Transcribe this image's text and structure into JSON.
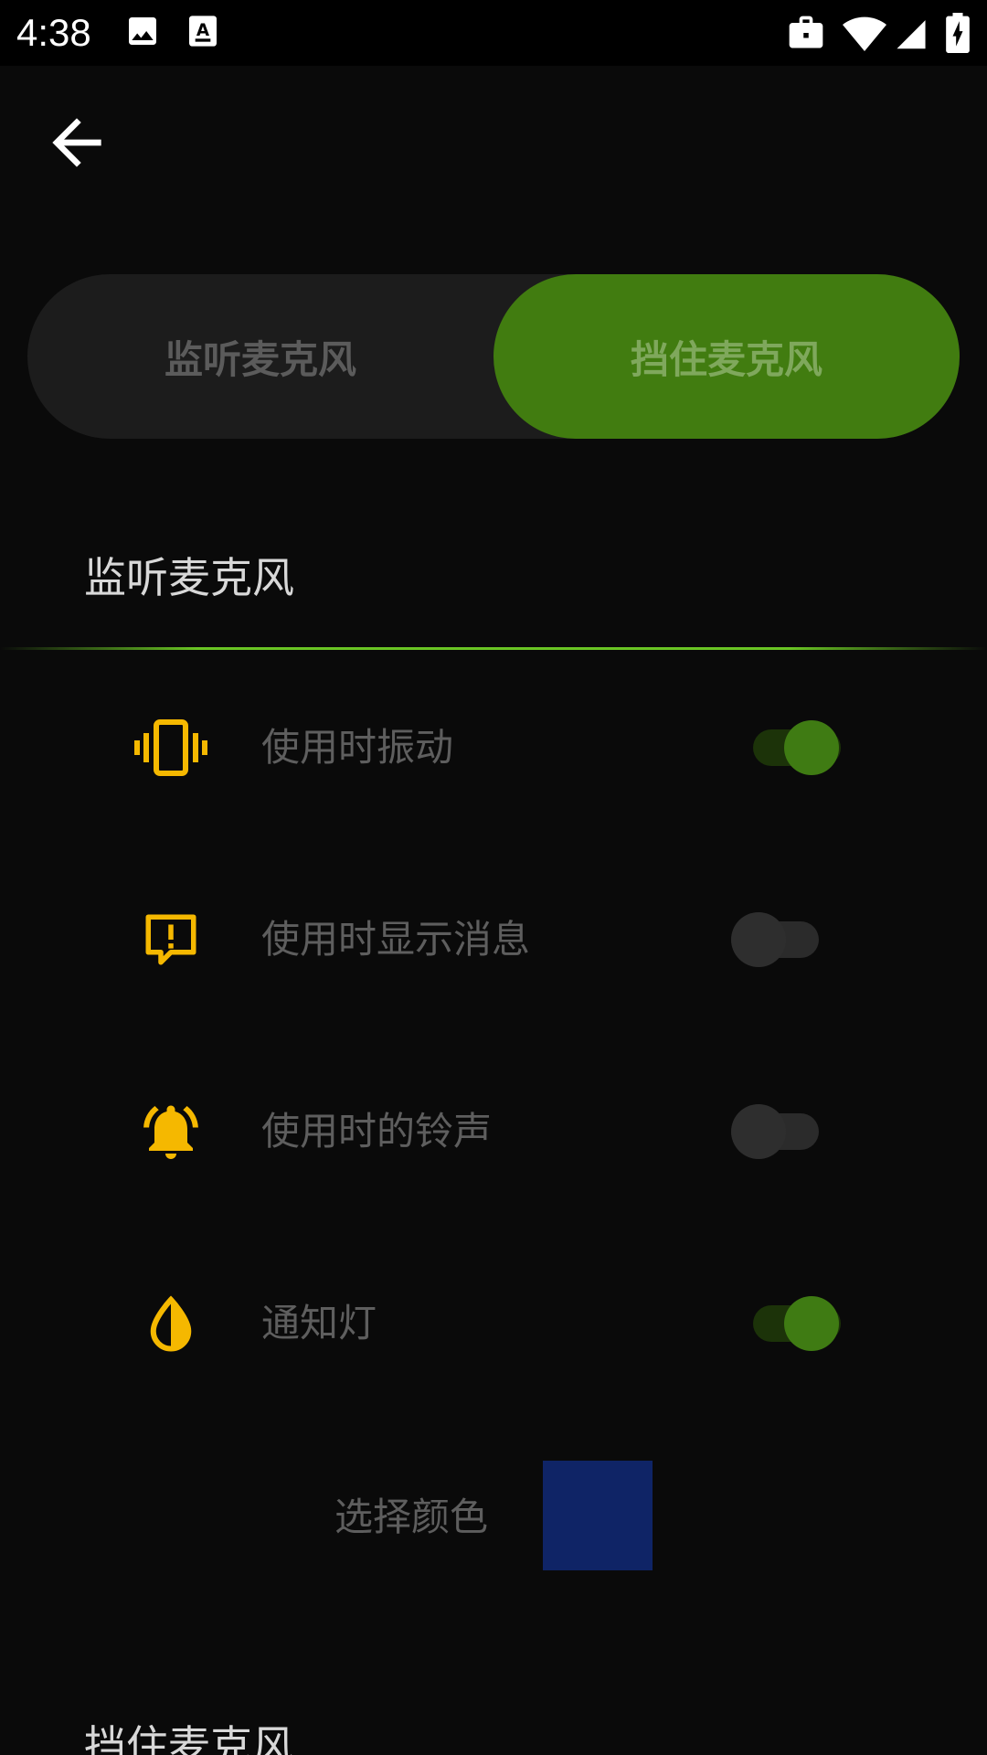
{
  "status_bar": {
    "time": "4:38",
    "icons": [
      "image-icon",
      "font-download-icon",
      "briefcase-icon",
      "wifi-icon",
      "signal-icon",
      "battery-charging-icon"
    ]
  },
  "toolbar": {
    "back_icon": "arrow-back-icon"
  },
  "tabs": [
    {
      "label": "监听麦克风",
      "selected": false
    },
    {
      "label": "挡住麦克风",
      "selected": true
    }
  ],
  "section": {
    "title": "监听麦克风"
  },
  "settings": [
    {
      "label": "使用时振动",
      "icon": "vibration-icon",
      "enabled": true
    },
    {
      "label": "使用时显示消息",
      "icon": "message-alert-icon",
      "enabled": false
    },
    {
      "label": "使用时的铃声",
      "icon": "bell-ringing-icon",
      "enabled": false
    },
    {
      "label": "通知灯",
      "icon": "light-drop-icon",
      "enabled": true
    }
  ],
  "color_picker": {
    "label": "选择颜色",
    "color": "#0f2466"
  },
  "next_section": {
    "title": "挡住麦克风"
  },
  "colors": {
    "accent": "#417c10",
    "icon": "#f5b800",
    "background": "#0a0a0a"
  }
}
